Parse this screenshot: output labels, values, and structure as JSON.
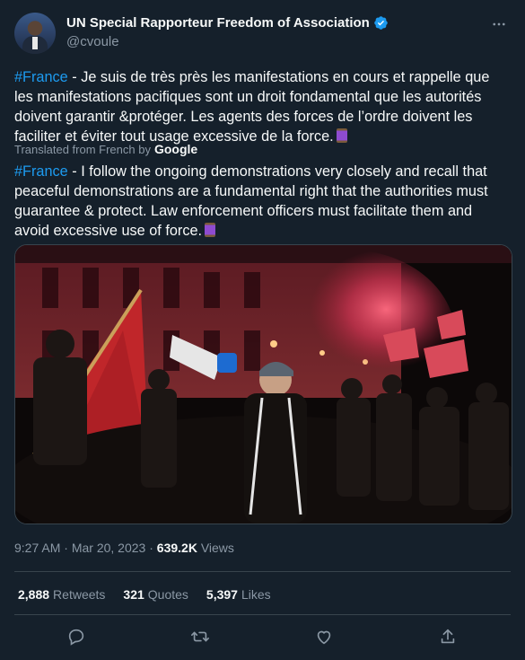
{
  "author": {
    "display_name": "UN Special Rapporteur Freedom of Association",
    "handle": "@cvoule",
    "verified_color": "#1d9bf0"
  },
  "tweet": {
    "hashtag": "#France",
    "original_body": " - Je suis de très près les manifestations en cours et rappelle que les manifestations pacifiques sont un droit fondamental que les autorités doivent garantir &protéger. Les agents des forces de l’ordre doivent les faciliter et éviter tout usage excessive de la force.",
    "translated_label": "Translated from French by",
    "translator": "Google",
    "translated_body": " - I follow the ongoing demonstrations very closely and recall that peaceful demonstrations are a fundamental right that the authorities must guarantee & protect. Law enforcement officers must facilitate them and avoid excessive use of force."
  },
  "meta": {
    "time": "9:27 AM",
    "separator": " · ",
    "date": "Mar 20, 2023",
    "views_count": "639.2K",
    "views_label": " Views"
  },
  "stats": {
    "retweets_count": "2,888",
    "retweets_label": "Retweets",
    "quotes_count": "321",
    "quotes_label": "Quotes",
    "likes_count": "5,397",
    "likes_label": "Likes"
  },
  "icons": {
    "more": "more-icon",
    "reply": "reply-icon",
    "retweet": "retweet-icon",
    "like": "like-icon",
    "share": "share-icon"
  },
  "colors": {
    "background": "#15202b",
    "hashtag": "#1d9bf0",
    "muted": "#8b98a5",
    "text": "#f7f9f9"
  }
}
